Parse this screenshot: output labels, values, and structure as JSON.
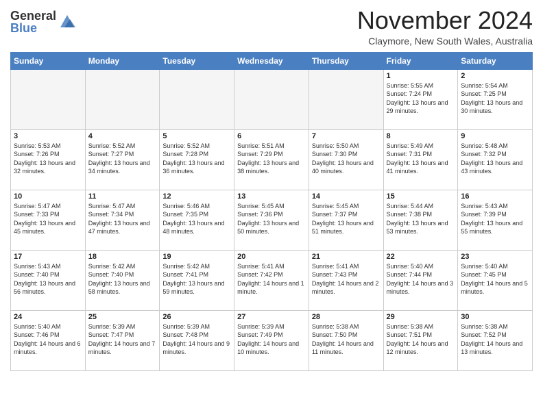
{
  "header": {
    "logo_general": "General",
    "logo_blue": "Blue",
    "month_title": "November 2024",
    "location": "Claymore, New South Wales, Australia"
  },
  "weekdays": [
    "Sunday",
    "Monday",
    "Tuesday",
    "Wednesday",
    "Thursday",
    "Friday",
    "Saturday"
  ],
  "weeks": [
    [
      {
        "day": "",
        "empty": true
      },
      {
        "day": "",
        "empty": true
      },
      {
        "day": "",
        "empty": true
      },
      {
        "day": "",
        "empty": true
      },
      {
        "day": "",
        "empty": true
      },
      {
        "day": "1",
        "sunrise": "5:55 AM",
        "sunset": "7:24 PM",
        "daylight": "13 hours and 29 minutes."
      },
      {
        "day": "2",
        "sunrise": "5:54 AM",
        "sunset": "7:25 PM",
        "daylight": "13 hours and 30 minutes."
      }
    ],
    [
      {
        "day": "3",
        "sunrise": "5:53 AM",
        "sunset": "7:26 PM",
        "daylight": "13 hours and 32 minutes."
      },
      {
        "day": "4",
        "sunrise": "5:52 AM",
        "sunset": "7:27 PM",
        "daylight": "13 hours and 34 minutes."
      },
      {
        "day": "5",
        "sunrise": "5:52 AM",
        "sunset": "7:28 PM",
        "daylight": "13 hours and 36 minutes."
      },
      {
        "day": "6",
        "sunrise": "5:51 AM",
        "sunset": "7:29 PM",
        "daylight": "13 hours and 38 minutes."
      },
      {
        "day": "7",
        "sunrise": "5:50 AM",
        "sunset": "7:30 PM",
        "daylight": "13 hours and 40 minutes."
      },
      {
        "day": "8",
        "sunrise": "5:49 AM",
        "sunset": "7:31 PM",
        "daylight": "13 hours and 41 minutes."
      },
      {
        "day": "9",
        "sunrise": "5:48 AM",
        "sunset": "7:32 PM",
        "daylight": "13 hours and 43 minutes."
      }
    ],
    [
      {
        "day": "10",
        "sunrise": "5:47 AM",
        "sunset": "7:33 PM",
        "daylight": "13 hours and 45 minutes."
      },
      {
        "day": "11",
        "sunrise": "5:47 AM",
        "sunset": "7:34 PM",
        "daylight": "13 hours and 47 minutes."
      },
      {
        "day": "12",
        "sunrise": "5:46 AM",
        "sunset": "7:35 PM",
        "daylight": "13 hours and 48 minutes."
      },
      {
        "day": "13",
        "sunrise": "5:45 AM",
        "sunset": "7:36 PM",
        "daylight": "13 hours and 50 minutes."
      },
      {
        "day": "14",
        "sunrise": "5:45 AM",
        "sunset": "7:37 PM",
        "daylight": "13 hours and 51 minutes."
      },
      {
        "day": "15",
        "sunrise": "5:44 AM",
        "sunset": "7:38 PM",
        "daylight": "13 hours and 53 minutes."
      },
      {
        "day": "16",
        "sunrise": "5:43 AM",
        "sunset": "7:39 PM",
        "daylight": "13 hours and 55 minutes."
      }
    ],
    [
      {
        "day": "17",
        "sunrise": "5:43 AM",
        "sunset": "7:40 PM",
        "daylight": "13 hours and 56 minutes."
      },
      {
        "day": "18",
        "sunrise": "5:42 AM",
        "sunset": "7:40 PM",
        "daylight": "13 hours and 58 minutes."
      },
      {
        "day": "19",
        "sunrise": "5:42 AM",
        "sunset": "7:41 PM",
        "daylight": "13 hours and 59 minutes."
      },
      {
        "day": "20",
        "sunrise": "5:41 AM",
        "sunset": "7:42 PM",
        "daylight": "14 hours and 1 minute."
      },
      {
        "day": "21",
        "sunrise": "5:41 AM",
        "sunset": "7:43 PM",
        "daylight": "14 hours and 2 minutes."
      },
      {
        "day": "22",
        "sunrise": "5:40 AM",
        "sunset": "7:44 PM",
        "daylight": "14 hours and 3 minutes."
      },
      {
        "day": "23",
        "sunrise": "5:40 AM",
        "sunset": "7:45 PM",
        "daylight": "14 hours and 5 minutes."
      }
    ],
    [
      {
        "day": "24",
        "sunrise": "5:40 AM",
        "sunset": "7:46 PM",
        "daylight": "14 hours and 6 minutes."
      },
      {
        "day": "25",
        "sunrise": "5:39 AM",
        "sunset": "7:47 PM",
        "daylight": "14 hours and 7 minutes."
      },
      {
        "day": "26",
        "sunrise": "5:39 AM",
        "sunset": "7:48 PM",
        "daylight": "14 hours and 9 minutes."
      },
      {
        "day": "27",
        "sunrise": "5:39 AM",
        "sunset": "7:49 PM",
        "daylight": "14 hours and 10 minutes."
      },
      {
        "day": "28",
        "sunrise": "5:38 AM",
        "sunset": "7:50 PM",
        "daylight": "14 hours and 11 minutes."
      },
      {
        "day": "29",
        "sunrise": "5:38 AM",
        "sunset": "7:51 PM",
        "daylight": "14 hours and 12 minutes."
      },
      {
        "day": "30",
        "sunrise": "5:38 AM",
        "sunset": "7:52 PM",
        "daylight": "14 hours and 13 minutes."
      }
    ]
  ]
}
